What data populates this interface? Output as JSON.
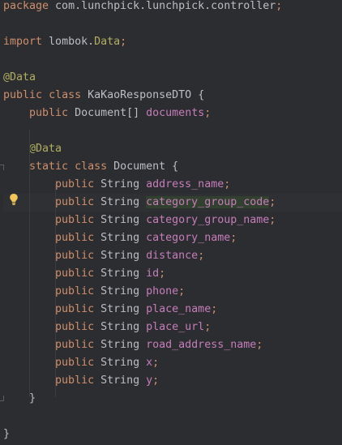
{
  "code": {
    "lines": [
      {
        "id": "l1",
        "tokens": [
          {
            "t": "package",
            "c": "kw"
          },
          {
            "t": " com.lunchpick.lunchpick.controller",
            "c": "plain"
          },
          {
            "t": ";",
            "c": "kw"
          }
        ]
      },
      {
        "id": "l2",
        "tokens": []
      },
      {
        "id": "l3",
        "tokens": [
          {
            "t": "import",
            "c": "kw"
          },
          {
            "t": " lombok.",
            "c": "plain"
          },
          {
            "t": "Data",
            "c": "ann"
          },
          {
            "t": ";",
            "c": "kw"
          }
        ]
      },
      {
        "id": "l4",
        "tokens": []
      },
      {
        "id": "l5",
        "tokens": [
          {
            "t": "@Data",
            "c": "ann"
          }
        ]
      },
      {
        "id": "l6",
        "tokens": [
          {
            "t": "public",
            "c": "kw"
          },
          {
            "t": " ",
            "c": "plain"
          },
          {
            "t": "class",
            "c": "kw"
          },
          {
            "t": " KaKaoResponseDTO {",
            "c": "plain"
          }
        ]
      },
      {
        "id": "l7",
        "tokens": [
          {
            "t": "    ",
            "c": "plain"
          },
          {
            "t": "public",
            "c": "kw"
          },
          {
            "t": " Document[] ",
            "c": "plain"
          },
          {
            "t": "documents",
            "c": "field"
          },
          {
            "t": ";",
            "c": "kw"
          }
        ]
      },
      {
        "id": "l8",
        "tokens": []
      },
      {
        "id": "l9",
        "tokens": [
          {
            "t": "    ",
            "c": "plain"
          },
          {
            "t": "@Data",
            "c": "ann"
          }
        ]
      },
      {
        "id": "l10",
        "tokens": [
          {
            "t": "    ",
            "c": "plain"
          },
          {
            "t": "static",
            "c": "kw"
          },
          {
            "t": " ",
            "c": "plain"
          },
          {
            "t": "class",
            "c": "kw"
          },
          {
            "t": " Document {",
            "c": "plain"
          }
        ]
      },
      {
        "id": "l11",
        "tokens": [
          {
            "t": "        ",
            "c": "plain"
          },
          {
            "t": "public",
            "c": "kw"
          },
          {
            "t": " String ",
            "c": "plain"
          },
          {
            "t": "address_name",
            "c": "field"
          },
          {
            "t": ";",
            "c": "kw"
          }
        ]
      },
      {
        "id": "l12",
        "tokens": [
          {
            "t": "        ",
            "c": "plain"
          },
          {
            "t": "public",
            "c": "kw"
          },
          {
            "t": " String ",
            "c": "plain"
          },
          {
            "t": "category_group_code",
            "c": "field hw"
          },
          {
            "t": ";",
            "c": "kw"
          }
        ]
      },
      {
        "id": "l13",
        "tokens": [
          {
            "t": "        ",
            "c": "plain"
          },
          {
            "t": "public",
            "c": "kw"
          },
          {
            "t": " String ",
            "c": "plain"
          },
          {
            "t": "category_group_name",
            "c": "field"
          },
          {
            "t": ";",
            "c": "kw"
          }
        ]
      },
      {
        "id": "l14",
        "tokens": [
          {
            "t": "        ",
            "c": "plain"
          },
          {
            "t": "public",
            "c": "kw"
          },
          {
            "t": " String ",
            "c": "plain"
          },
          {
            "t": "category_name",
            "c": "field"
          },
          {
            "t": ";",
            "c": "kw"
          }
        ]
      },
      {
        "id": "l15",
        "tokens": [
          {
            "t": "        ",
            "c": "plain"
          },
          {
            "t": "public",
            "c": "kw"
          },
          {
            "t": " String ",
            "c": "plain"
          },
          {
            "t": "distance",
            "c": "field"
          },
          {
            "t": ";",
            "c": "kw"
          }
        ]
      },
      {
        "id": "l16",
        "tokens": [
          {
            "t": "        ",
            "c": "plain"
          },
          {
            "t": "public",
            "c": "kw"
          },
          {
            "t": " String ",
            "c": "plain"
          },
          {
            "t": "id",
            "c": "field"
          },
          {
            "t": ";",
            "c": "kw"
          }
        ]
      },
      {
        "id": "l17",
        "tokens": [
          {
            "t": "        ",
            "c": "plain"
          },
          {
            "t": "public",
            "c": "kw"
          },
          {
            "t": " String ",
            "c": "plain"
          },
          {
            "t": "phone",
            "c": "field"
          },
          {
            "t": ";",
            "c": "kw"
          }
        ]
      },
      {
        "id": "l18",
        "tokens": [
          {
            "t": "        ",
            "c": "plain"
          },
          {
            "t": "public",
            "c": "kw"
          },
          {
            "t": " String ",
            "c": "plain"
          },
          {
            "t": "place_name",
            "c": "field"
          },
          {
            "t": ";",
            "c": "kw"
          }
        ]
      },
      {
        "id": "l19",
        "tokens": [
          {
            "t": "        ",
            "c": "plain"
          },
          {
            "t": "public",
            "c": "kw"
          },
          {
            "t": " String ",
            "c": "plain"
          },
          {
            "t": "place_url",
            "c": "field"
          },
          {
            "t": ";",
            "c": "kw"
          }
        ]
      },
      {
        "id": "l20",
        "tokens": [
          {
            "t": "        ",
            "c": "plain"
          },
          {
            "t": "public",
            "c": "kw"
          },
          {
            "t": " String ",
            "c": "plain"
          },
          {
            "t": "road_address_name",
            "c": "field"
          },
          {
            "t": ";",
            "c": "kw"
          }
        ]
      },
      {
        "id": "l21",
        "tokens": [
          {
            "t": "        ",
            "c": "plain"
          },
          {
            "t": "public",
            "c": "kw"
          },
          {
            "t": " String ",
            "c": "plain"
          },
          {
            "t": "x",
            "c": "field"
          },
          {
            "t": ";",
            "c": "kw"
          }
        ]
      },
      {
        "id": "l22",
        "tokens": [
          {
            "t": "        ",
            "c": "plain"
          },
          {
            "t": "public",
            "c": "kw"
          },
          {
            "t": " String ",
            "c": "plain"
          },
          {
            "t": "y",
            "c": "field"
          },
          {
            "t": ";",
            "c": "kw"
          }
        ]
      },
      {
        "id": "l23",
        "tokens": [
          {
            "t": "    }",
            "c": "plain"
          }
        ]
      },
      {
        "id": "l24",
        "tokens": []
      },
      {
        "id": "l25",
        "tokens": [
          {
            "t": "}",
            "c": "plain"
          }
        ]
      }
    ],
    "highlighted_line_index": 11,
    "intention_icon": "lightbulb-icon"
  },
  "colors": {
    "background": "#2b2d30",
    "keyword": "#cf8e6d",
    "annotation": "#b3ae60",
    "field": "#c77dbb",
    "plain": "#bcbec4",
    "current_line": "#2e3033",
    "word_highlight": "#32412f",
    "bulb": "#f2c55c"
  }
}
